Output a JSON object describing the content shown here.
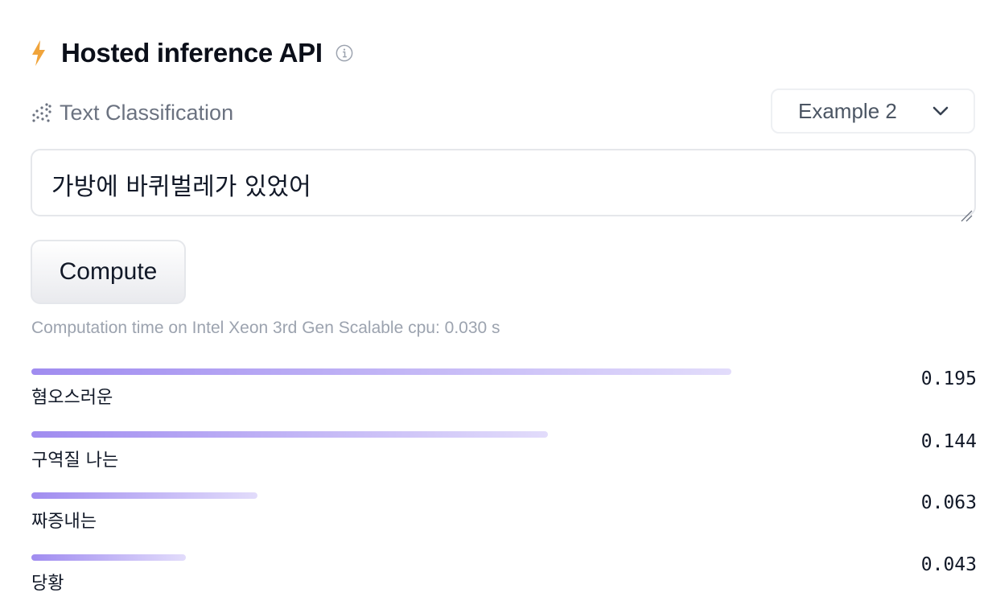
{
  "header": {
    "title": "Hosted inference API",
    "icon": "lightning-icon",
    "info_icon": "info-icon"
  },
  "task": {
    "label": "Text Classification",
    "icon": "text-classification-icon"
  },
  "example_select": {
    "value": "Example 2"
  },
  "input": {
    "value": "가방에 바퀴벌레가 있었어"
  },
  "compute_button": {
    "label": "Compute"
  },
  "computation_time": "Computation time on Intel Xeon 3rd Gen Scalable cpu: 0.030 s",
  "accent_color": "#a08cf0",
  "results": [
    {
      "label": "혐오스러운",
      "score": "0.195",
      "fraction": 0.195
    },
    {
      "label": "구역질  나는",
      "score": "0.144",
      "fraction": 0.144
    },
    {
      "label": "짜증내는",
      "score": "0.063",
      "fraction": 0.063
    },
    {
      "label": "당황",
      "score": "0.043",
      "fraction": 0.043
    }
  ]
}
